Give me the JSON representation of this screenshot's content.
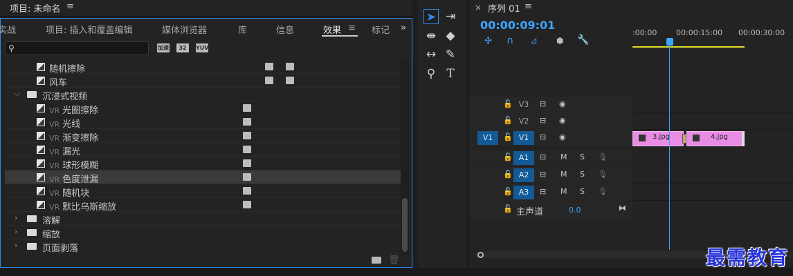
{
  "project": {
    "title": "项目: 未命名",
    "menu_icon": "≡"
  },
  "effects_panel": {
    "tabs": [
      "实战",
      "项目: 插入和覆盖编辑",
      "媒体浏览器",
      "库",
      "信息",
      "效果",
      "标记"
    ],
    "active_tab": "效果",
    "tab_menu_icon": "≡",
    "overflow_icon": "»",
    "search": {
      "value": "",
      "icon": "search-icon"
    },
    "filter_badges": [
      "加速",
      "32",
      "YUV"
    ],
    "tree": [
      {
        "kind": "effect",
        "label": "随机擦除",
        "badges": [
          "32",
          "YUV"
        ]
      },
      {
        "kind": "effect",
        "label": "风车",
        "badges": [
          "32",
          "YUV"
        ]
      },
      {
        "kind": "folder",
        "label": "沉浸式视频",
        "expanded": true
      },
      {
        "kind": "vr",
        "prefix": "VR",
        "label": "光圈擦除",
        "badges": [
          "加速"
        ]
      },
      {
        "kind": "vr",
        "prefix": "VR",
        "label": "光线",
        "badges": [
          "加速"
        ]
      },
      {
        "kind": "vr",
        "prefix": "VR",
        "label": "渐变擦除",
        "badges": [
          "加速"
        ]
      },
      {
        "kind": "vr",
        "prefix": "VR",
        "label": "漏光",
        "badges": [
          "加速"
        ]
      },
      {
        "kind": "vr",
        "prefix": "VR",
        "label": "球形模糊",
        "badges": [
          "加速"
        ]
      },
      {
        "kind": "vr",
        "prefix": "VR",
        "label": "色度泄漏",
        "badges": [
          "加速"
        ],
        "selected": true
      },
      {
        "kind": "vr",
        "prefix": "VR",
        "label": "随机块",
        "badges": [
          "加速"
        ]
      },
      {
        "kind": "vr",
        "prefix": "VR",
        "label": "默比乌斯缩放",
        "badges": [
          "加速"
        ]
      },
      {
        "kind": "folder",
        "label": "溶解",
        "expanded": false
      },
      {
        "kind": "folder",
        "label": "缩放",
        "expanded": false
      },
      {
        "kind": "folder",
        "label": "页面剥落",
        "expanded": false
      }
    ]
  },
  "timeline": {
    "close": "×",
    "title": "序列 01",
    "menu_icon": "≡",
    "timecode": "00:00:09:01",
    "ruler_ticks": [
      ":00:00",
      "00:00:15:00",
      "00:00:30:00"
    ],
    "tracks": [
      {
        "name": "V3",
        "type": "video",
        "source": "",
        "target_on": false
      },
      {
        "name": "V2",
        "type": "video",
        "source": "",
        "target_on": false
      },
      {
        "name": "V1",
        "type": "video",
        "source": "V1",
        "target_on": true
      },
      {
        "name": "A1",
        "type": "audio",
        "source": "",
        "target_on": true,
        "mute": "M",
        "solo": "S"
      },
      {
        "name": "A2",
        "type": "audio",
        "source": "",
        "target_on": true,
        "mute": "M",
        "solo": "S"
      },
      {
        "name": "A3",
        "type": "audio",
        "source": "",
        "target_on": true,
        "mute": "M",
        "solo": "S"
      }
    ],
    "master": {
      "label": "主声道",
      "value": "0.0"
    },
    "clips": [
      {
        "name": "3.jpg",
        "track": "V1",
        "color": "#e88ce4"
      },
      {
        "name": "4.jpg",
        "track": "V1",
        "color": "#e88ce4"
      }
    ]
  },
  "watermark": "最需教育",
  "colors": {
    "accent": "#2d8ceb",
    "timecode": "#3da5ff",
    "clip": "#e88ce4",
    "work_area": "#dede2a"
  }
}
